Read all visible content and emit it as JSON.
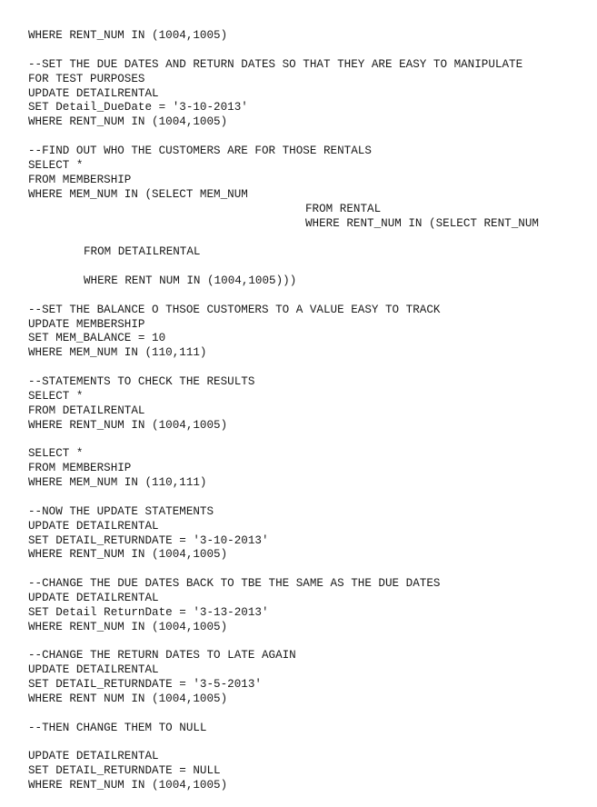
{
  "lines": [
    "WHERE RENT_NUM IN (1004,1005)",
    "--SET THE DUE DATES AND RETURN DATES SO THAT THEY ARE EASY TO MANIPULATE",
    "FOR TEST PURPOSES",
    "UPDATE DETAILRENTAL",
    "SET Detail_DueDate = '3-10-2013'",
    "WHERE RENT_NUM IN (1004,1005)",
    "--FIND OUT WHO THE CUSTOMERS ARE FOR THOSE RENTALS",
    "SELECT *",
    "FROM MEMBERSHIP",
    "WHERE MEM_NUM IN (SELECT MEM_NUM",
    "FROM RENTAL",
    "WHERE RENT_NUM IN (SELECT RENT_NUM",
    "FROM DETAILRENTAL",
    "WHERE RENT NUM IN (1004,1005)))",
    "--SET THE BALANCE O THSOE CUSTOMERS TO A VALUE EASY TO TRACK",
    "UPDATE MEMBERSHIP",
    "SET MEM_BALANCE = 10",
    "WHERE MEM_NUM IN (110,111)",
    "--STATEMENTS TO CHECK THE RESULTS",
    "SELECT *",
    "FROM DETAILRENTAL",
    "WHERE RENT_NUM IN (1004,1005)",
    "SELECT *",
    "FROM MEMBERSHIP",
    "WHERE MEM_NUM IN (110,111)",
    "--NOW THE UPDATE STATEMENTS",
    "UPDATE DETAILRENTAL",
    "SET DETAIL_RETURNDATE = '3-10-2013'",
    "WHERE RENT_NUM IN (1004,1005)",
    "--CHANGE THE DUE DATES BACK TO TBE THE SAME AS THE DUE DATES",
    "UPDATE DETAILRENTAL",
    "SET Detail ReturnDate = '3-13-2013'",
    "WHERE RENT_NUM IN (1004,1005)",
    "--CHANGE THE RETURN DATES TO LATE AGAIN",
    "UPDATE DETAILRENTAL",
    "SET DETAIL_RETURNDATE = '3-5-2013'",
    "WHERE RENT NUM IN (1004,1005)",
    "--THEN CHANGE THEM TO NULL",
    "UPDATE DETAILRENTAL",
    "SET DETAIL_RETURNDATE = NULL",
    "WHERE RENT_NUM IN (1004,1005)"
  ]
}
